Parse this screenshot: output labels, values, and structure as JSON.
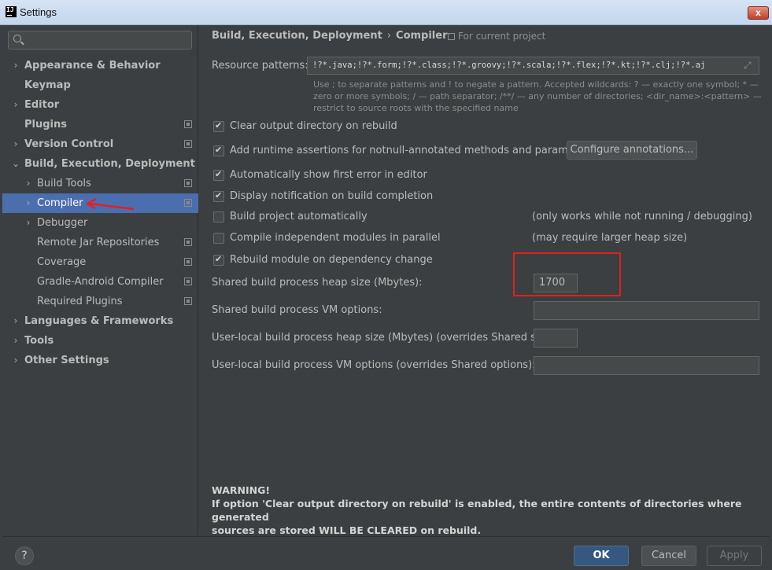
{
  "window": {
    "title": "Settings",
    "close_label": "x"
  },
  "search": {
    "placeholder": ""
  },
  "sidebar": {
    "items": [
      {
        "label": "Appearance & Behavior",
        "arrow": "›",
        "bold": true,
        "proj": false
      },
      {
        "label": "Keymap",
        "arrow": "",
        "bold": true,
        "proj": false
      },
      {
        "label": "Editor",
        "arrow": "›",
        "bold": true,
        "proj": false
      },
      {
        "label": "Plugins",
        "arrow": "",
        "bold": true,
        "proj": true
      },
      {
        "label": "Version Control",
        "arrow": "›",
        "bold": true,
        "proj": true
      },
      {
        "label": "Build, Execution, Deployment",
        "arrow": "⌄",
        "bold": true,
        "proj": false
      },
      {
        "label": "Build Tools",
        "arrow": "›",
        "bold": false,
        "proj": true
      },
      {
        "label": "Compiler",
        "arrow": "›",
        "bold": false,
        "proj": true,
        "selected": true
      },
      {
        "label": "Debugger",
        "arrow": "›",
        "bold": false,
        "proj": false
      },
      {
        "label": "Remote Jar Repositories",
        "arrow": "",
        "bold": false,
        "proj": true
      },
      {
        "label": "Coverage",
        "arrow": "",
        "bold": false,
        "proj": true
      },
      {
        "label": "Gradle-Android Compiler",
        "arrow": "",
        "bold": false,
        "proj": true
      },
      {
        "label": "Required Plugins",
        "arrow": "",
        "bold": false,
        "proj": true
      },
      {
        "label": "Languages & Frameworks",
        "arrow": "›",
        "bold": true,
        "proj": false
      },
      {
        "label": "Tools",
        "arrow": "›",
        "bold": true,
        "proj": false
      },
      {
        "label": "Other Settings",
        "arrow": "›",
        "bold": true,
        "proj": false
      }
    ]
  },
  "breadcrumb": {
    "parent": "Build, Execution, Deployment",
    "sep": "›",
    "current": "Compiler",
    "scope": "For current project"
  },
  "resource": {
    "label": "Resource patterns:",
    "value": "!?*.java;!?*.form;!?*.class;!?*.groovy;!?*.scala;!?*.flex;!?*.kt;!?*.clj;!?*.aj",
    "expand_icon": "⤢",
    "hint": "Use ; to separate patterns and ! to negate a pattern. Accepted wildcards: ? — exactly one symbol; * — zero or more symbols; / — path separator; /**/ — any number of directories; <dir_name>:<pattern> — restrict to source roots with the specified name"
  },
  "options": {
    "clear_output": {
      "label": "Clear output directory on rebuild",
      "checked": true
    },
    "runtime_assertions": {
      "label": "Add runtime assertions for notnull-annotated methods and parameters",
      "checked": true
    },
    "configure_annotations": "Configure annotations...",
    "show_first_error": {
      "label": "Automatically show first error in editor",
      "checked": true
    },
    "display_notification": {
      "label": "Display notification on build completion",
      "checked": true
    },
    "build_automatically": {
      "label": "Build project automatically",
      "checked": false,
      "note": "(only works while not running / debugging)"
    },
    "compile_parallel": {
      "label": "Compile independent modules in parallel",
      "checked": false,
      "note": "(may require larger heap size)"
    },
    "rebuild_on_dependency": {
      "label": "Rebuild module on dependency change",
      "checked": true
    }
  },
  "fields": {
    "shared_heap": {
      "label": "Shared build process heap size (Mbytes):",
      "value": "1700"
    },
    "shared_vm": {
      "label": "Shared build process VM options:",
      "value": ""
    },
    "user_heap": {
      "label": "User-local build process heap size (Mbytes) (overrides Shared size):",
      "value": ""
    },
    "user_vm": {
      "label": "User-local build process VM options (overrides Shared options):",
      "value": ""
    }
  },
  "warning": {
    "title": "WARNING!",
    "line1": "If option 'Clear output directory on rebuild' is enabled, the entire contents of directories where generated",
    "line2": "sources are stored WILL BE CLEARED on rebuild."
  },
  "footer": {
    "help": "?",
    "ok": "OK",
    "cancel": "Cancel",
    "apply": "Apply"
  },
  "colors": {
    "selection": "#4b6eaf",
    "annotation_red": "#e02020",
    "ok_button": "#365880"
  }
}
